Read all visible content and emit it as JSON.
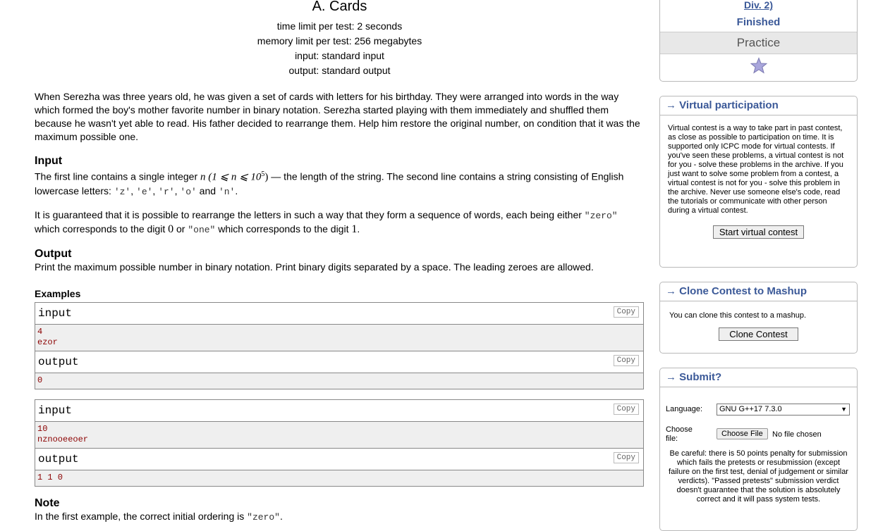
{
  "problem": {
    "title": "A. Cards",
    "time_limit": "time limit per test: 2 seconds",
    "memory_limit": "memory limit per test: 256 megabytes",
    "input_file": "input: standard input",
    "output_file": "output: standard output",
    "legend": "When Serezha was three years old, he was given a set of cards with letters for his birthday. They were arranged into words in the way which formed the boy's mother favorite number in binary notation. Serezha started playing with them immediately and shuffled them because he wasn't yet able to read. His father decided to rearrange them. Help him restore the original number, on condition that it was the maximum possible one.",
    "input_title": "Input",
    "input_text_1a": "The first line contains a single integer ",
    "input_math": "n (1 ⩽ n ⩽ 10",
    "input_math_sup": "5",
    "input_math_end": ")",
    "input_text_1b": " — the length of the string. The second line contains a string consisting of English lowercase letters: ",
    "letters": [
      "'z'",
      "'e'",
      "'r'",
      "'o'",
      "'n'"
    ],
    "sep1": ", ",
    "and": " and ",
    "period": ".",
    "input_text_2a": "It is guaranteed that it is possible to rearrange the letters in such a way that they form a sequence of words, each being either ",
    "zero_word": "\"zero\"",
    "input_text_2b": " which corresponds to the digit ",
    "digit_0": "0",
    "input_text_2c": " or ",
    "one_word": "\"one\"",
    "input_text_2d": " which corresponds to the digit ",
    "digit_1": "1",
    "output_title": "Output",
    "output_text": "Print the maximum possible number in binary notation. Print binary digits separated by a space. The leading zeroes are allowed.",
    "examples_title": "Examples",
    "copy_label": "Copy",
    "examples": [
      {
        "input_label": "input",
        "input_lines": [
          "4",
          "ezor"
        ],
        "output_label": "output",
        "output_lines": [
          "0"
        ]
      },
      {
        "input_label": "input",
        "input_lines": [
          "10",
          "nznooeeoer"
        ],
        "output_label": "output",
        "output_lines": [
          "1 1 0"
        ]
      }
    ],
    "note_title": "Note",
    "note_text_a": "In the first example, the correct initial ordering is ",
    "note_code": "\"zero\"",
    "note_text_b": "."
  },
  "sidebar": {
    "contest_div": "Div. 2)",
    "status": "Finished",
    "practice": "Practice",
    "star_icon": "star-icon",
    "virtual": {
      "heading": "Virtual participation",
      "text": "Virtual contest is a way to take part in past contest, as close as possible to participation on time. It is supported only ICPC mode for virtual contests. If you've seen these problems, a virtual contest is not for you - solve these problems in the archive. If you just want to solve some problem from a contest, a virtual contest is not for you - solve this problem in the archive. Never use someone else's code, read the tutorials or communicate with other person during a virtual contest.",
      "button": "Start virtual contest"
    },
    "clone": {
      "heading": "Clone Contest to Mashup",
      "text": "You can clone this contest to a mashup.",
      "button": "Clone Contest"
    },
    "submit": {
      "heading": "Submit?",
      "language_label": "Language:",
      "language_value": "GNU G++17 7.3.0",
      "file_label": "Choose file:",
      "file_button": "Choose File",
      "file_status": "No file chosen",
      "warning": "Be careful: there is 50 points penalty for submission which fails the pretests or resubmission (except failure on the first test, denial of judgement or similar verdicts). \"Passed pretests\" submission verdict doesn't guarantee that the solution is absolutely correct and it will pass system tests."
    },
    "arrow": "→"
  }
}
